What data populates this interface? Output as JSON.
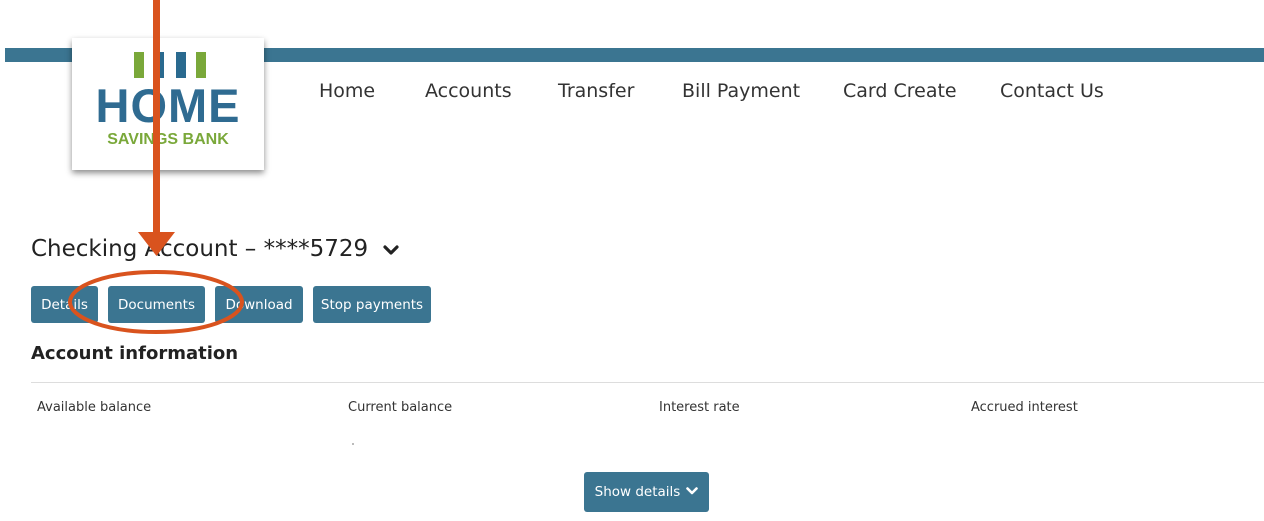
{
  "colors": {
    "brand_blue": "#3b7591",
    "logo_blue": "#2f6b91",
    "logo_green": "#7aa83a",
    "annotation": "#d9531e"
  },
  "logo": {
    "line1": "HOME",
    "line2": "SAVINGS BANK"
  },
  "nav": {
    "items": [
      "Home",
      "Accounts",
      "Transfer",
      "Bill Payment",
      "Card Create",
      "Contact Us"
    ]
  },
  "account": {
    "title": "Checking Account – ****5729",
    "dropdown_icon": "chevron-down-icon"
  },
  "actions": {
    "details": "Details",
    "documents": "Documents",
    "download": "Download",
    "stop_payments": "Stop payments"
  },
  "account_info": {
    "heading": "Account information",
    "columns": [
      "Available balance",
      "Current balance",
      "Interest rate",
      "Accrued interest"
    ]
  },
  "show_details": {
    "label": "Show details",
    "icon": "chevron-down-icon"
  }
}
